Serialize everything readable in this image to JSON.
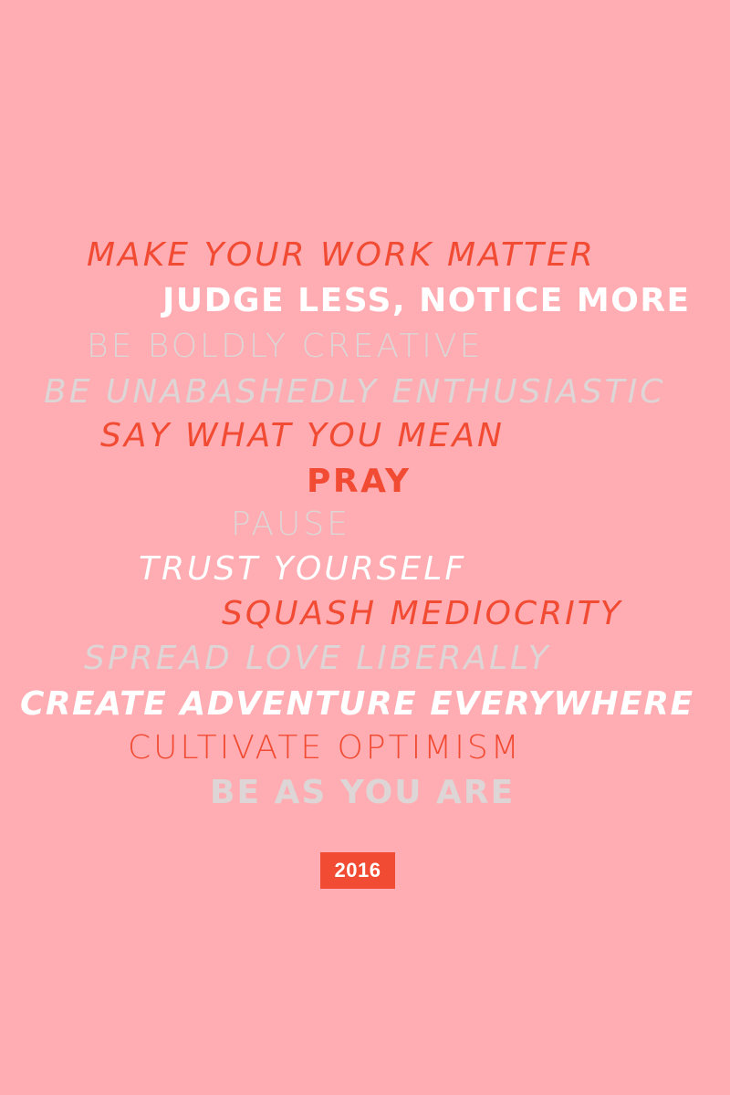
{
  "poster": {
    "lines": [
      "MAKE YOUR WORK MATTER",
      "JUDGE LESS, NOTICE MORE",
      "BE BOLDLY CREATIVE",
      "BE UNABASHEDLY ENTHUSIASTIC",
      "SAY WHAT YOU MEAN",
      "PRAY",
      "PAUSE",
      "TRUST YOURSELF",
      "SQUASH MEDIOCRITY",
      "SPREAD LOVE LIBERALLY",
      "CREATE ADVENTURE EVERYWHERE",
      "CULTIVATE OPTIMISM",
      "BE AS YOU ARE"
    ],
    "year": "2016"
  },
  "colors": {
    "background": "#ffadb2",
    "coral": "#f24b33",
    "white": "#ffffff",
    "grey": "#ddd5d6"
  }
}
